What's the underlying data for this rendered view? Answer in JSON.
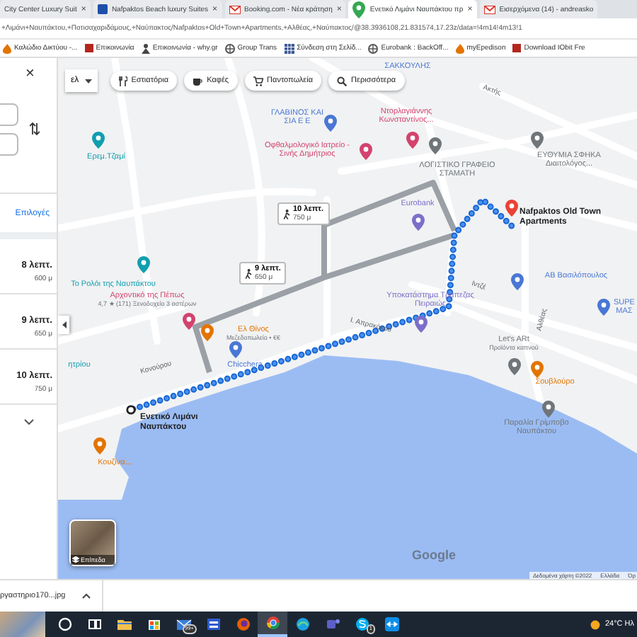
{
  "browser": {
    "tabs": [
      {
        "kind": "none",
        "title": "City Center Luxury Suit",
        "close": "×",
        "selected": false
      },
      {
        "kind": "hotel",
        "title": "Nafpaktos Beach luxury Suites",
        "close": "×",
        "selected": false
      },
      {
        "kind": "mail",
        "title": "Booking.com - Νέα κράτηση",
        "close": "×",
        "selected": false
      },
      {
        "kind": "maps",
        "title": "Ενετικό Λιμάνι Ναυπάκτου πρ",
        "close": "×",
        "selected": true
      },
      {
        "kind": "mail",
        "title": "Εισερχόμενα (14) - andreasko",
        "selected": false
      }
    ],
    "address": "+Λιμάνι+Ναυπάκτου,+Ποτισαχαριδάμους,+Ναύπακτος/Nafpaktos+Old+Town+Apartments,+Αλθέας,+Ναύπακτος/@38.3936108,21.831574,17.23z/data=!4m14!4m13!1",
    "bookmarks": [
      {
        "kind": "flame",
        "label": "Καλώδιο Δικτύου -..."
      },
      {
        "kind": "square",
        "label": "Επικοινωνία"
      },
      {
        "kind": "person",
        "label": "Επικοινωνία - why.gr"
      },
      {
        "kind": "globe",
        "label": "Group Trans"
      },
      {
        "kind": "grid",
        "label": "Σύνδεση στη Σελίδ..."
      },
      {
        "kind": "globe",
        "label": "Eurobank : BackOff..."
      },
      {
        "kind": "flame",
        "label": "myEpedison"
      },
      {
        "kind": "square",
        "label": "Download IObit Fre"
      }
    ]
  },
  "directions": {
    "close": "×",
    "options": "Επιλογές",
    "routes": [
      {
        "time": "8 λεπτ.",
        "distance": "600 μ"
      },
      {
        "time": "9 λεπτ.",
        "distance": "650 μ"
      },
      {
        "time": "10 λεπτ.",
        "distance": "750 μ"
      }
    ]
  },
  "map": {
    "language": "ελ",
    "chips": [
      {
        "kind": "restaurants",
        "label": "Εστιατόρια"
      },
      {
        "kind": "coffee",
        "label": "Καφές"
      },
      {
        "kind": "groceries",
        "label": "Παντοπωλεία"
      },
      {
        "kind": "search",
        "label": "Περισσότερα"
      }
    ],
    "walk_labels": [
      {
        "time": "10 λεπτ.",
        "distance": "750 μ"
      },
      {
        "time": "9 λεπτ.",
        "distance": "650 μ"
      }
    ],
    "places": [
      {
        "kind": "label",
        "name": "ΣΑΚΚΟΥΛΗΣ",
        "color": "#4a77d4"
      },
      {
        "kind": "pin",
        "name": "ΓΛΑΒΙΝΟΣ ΚΑΙ ΣΙΑ Ε Ε",
        "color": "#4a77d4"
      },
      {
        "kind": "pin",
        "name": "Ντορλαγιάννης Κωνσταντίνος...",
        "color": "#d3436e"
      },
      {
        "kind": "pin",
        "name": "Ερεμ.Τζαμί",
        "color": "#129eaf"
      },
      {
        "kind": "pin",
        "name": "Οφθαλμολογικό Ιατρείο - Σινής Δημήτριος",
        "color": "#d3436e"
      },
      {
        "kind": "pin",
        "name": "ΛΟΓΙΣΤΙΚΟ ΓΡΑΦΕΙΟ ΣΤΑΜΑΤΗ",
        "color": "#70757a"
      },
      {
        "kind": "pin",
        "name": "ΕΥΘΥΜΙΑ ΣΦΗΚΑ Διαιτολόγος...",
        "color": "#70757a"
      },
      {
        "kind": "pin",
        "name": "Eurobank",
        "color": "#7b6fc9"
      },
      {
        "kind": "destination",
        "name": "Nafpaktos Old Town Apartments",
        "color": "#ea4335"
      },
      {
        "kind": "pin",
        "name": "Το Ρολόι της Ναυπάκτου",
        "color": "#129eaf"
      },
      {
        "kind": "pin",
        "name": "Αρχοντικό της Πέπως",
        "detail": "4,7 ★ (171) Ξενοδοχείο 3 αστέρων",
        "color": "#d3436e"
      },
      {
        "kind": "pin",
        "name": "Υποκατάστημα Τράπεζας Πειραιώς",
        "color": "#7b6fc9"
      },
      {
        "kind": "pin",
        "name": "ΑΒ Βασιλόπουλος",
        "color": "#4a77d4"
      },
      {
        "kind": "pin",
        "name": "SUPE ΜΑΣ",
        "color": "#4a77d4"
      },
      {
        "kind": "pin",
        "name": "Ελ Θίνος",
        "detail": "Μεζεδοπωλείο • €€",
        "color": "#e37400"
      },
      {
        "kind": "pin",
        "name": "Let's ARt",
        "detail": "Προϊόντα καπνού",
        "color": "#70757a"
      },
      {
        "kind": "label",
        "name": "ητρίου",
        "color": "#129eaf"
      },
      {
        "kind": "pin",
        "name": "Chicchera",
        "color": "#4a77d4"
      },
      {
        "kind": "pin",
        "name": "Σουβλούρο",
        "color": "#e37400"
      },
      {
        "kind": "origin",
        "name": "Ενετικό Λιμάνι Ναυπάκτου",
        "color": "#202124"
      },
      {
        "kind": "pin",
        "name": "Παραλία Γρίμποβο Ναυπάκτου",
        "color": "#70757a"
      },
      {
        "kind": "pin",
        "name": "Κουζίνα...",
        "color": "#e37400"
      }
    ],
    "streets": [
      "Ακτής",
      "Ιντζέ",
      "Ι. Απρακάκου",
      "Αλθέας",
      "Κονούρου"
    ],
    "layers": "Επίπεδα",
    "logo": "Google",
    "footer": [
      "Δεδομένα χάρτη ©2022",
      "Ελλάδα",
      "Όρ"
    ]
  },
  "downloads": {
    "file": "ργαστηριο170...jpg"
  },
  "taskbar": {
    "apps": [
      {
        "kind": "search",
        "selected": false
      },
      {
        "kind": "taskview",
        "selected": false
      },
      {
        "kind": "explorer",
        "selected": false
      },
      {
        "kind": "store",
        "selected": false
      },
      {
        "kind": "mail",
        "selected": false,
        "badge": "99+"
      },
      {
        "kind": "app",
        "selected": false
      },
      {
        "kind": "firefox",
        "selected": false
      },
      {
        "kind": "chrome",
        "selected": true
      },
      {
        "kind": "edge",
        "selected": false
      },
      {
        "kind": "teams",
        "selected": false
      },
      {
        "kind": "skype",
        "selected": false,
        "badge": "1"
      },
      {
        "kind": "teamviewer",
        "selected": false
      }
    ],
    "weather": "24°C Ηλ"
  }
}
